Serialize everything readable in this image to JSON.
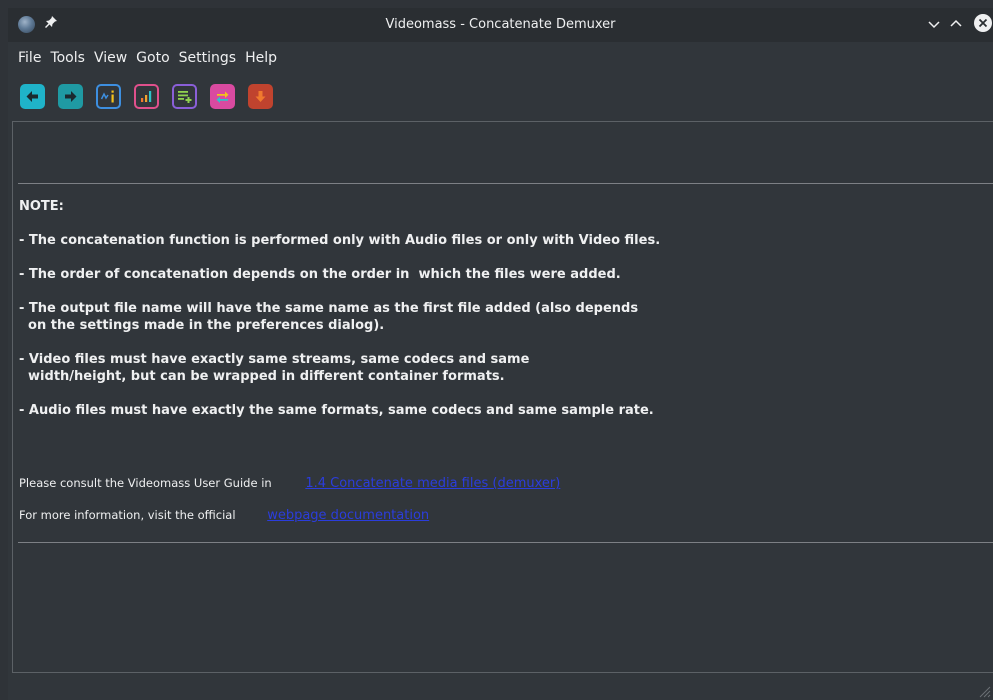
{
  "window": {
    "title": "Videomass - Concatenate Demuxer"
  },
  "menu": [
    "File",
    "Tools",
    "View",
    "Goto",
    "Settings",
    "Help"
  ],
  "toolbar": [
    {
      "name": "back-button",
      "icon": "arrow-left-icon",
      "color": "#1fb3c9"
    },
    {
      "name": "forward-button",
      "icon": "arrow-right-icon",
      "color": "#1fa0a8"
    },
    {
      "name": "media-info-button",
      "icon": "info-icon",
      "color": "#3d8fe0"
    },
    {
      "name": "volume-analysis-button",
      "icon": "bar-chart-icon",
      "color": "#e0508c"
    },
    {
      "name": "add-to-queue-button",
      "icon": "list-add-icon",
      "color": "#8a5fd8"
    },
    {
      "name": "queue-button",
      "icon": "swap-icon",
      "color": "#d94aa0"
    },
    {
      "name": "convert-button",
      "icon": "arrow-down-icon",
      "color": "#c0432e"
    }
  ],
  "note": {
    "heading": "NOTE:",
    "lines": [
      "- The concatenation function is performed only with Audio files or only with Video files.",
      "- The order of concatenation depends on the order in  which the files were added.",
      "- The output file name will have the same name as the first file added (also depends\n  on the settings made in the preferences dialog).",
      "- Video files must have exactly same streams, same codecs and same\n  width/height, but can be wrapped in different container formats.",
      "- Audio files must have exactly the same formats, same codecs and same sample rate."
    ]
  },
  "links": {
    "guide_prefix": "Please consult the Videomass User Guide in",
    "guide_link": "1.4 Concatenate media files (demuxer)",
    "docs_prefix": "For more information, visit the official",
    "docs_link": "webpage documentation"
  }
}
